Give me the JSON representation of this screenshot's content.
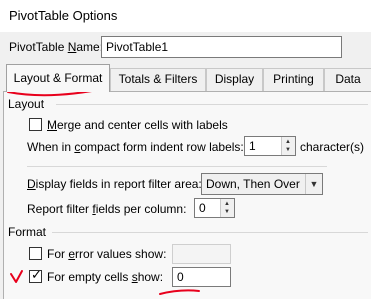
{
  "window": {
    "title": "PivotTable Options"
  },
  "name_field": {
    "label_prefix": "PivotTable ",
    "label_mnemonic": "N",
    "label_suffix": "ame:",
    "value": "PivotTable1"
  },
  "tabs": [
    {
      "label": "Layout & Format",
      "active": true
    },
    {
      "label": "Totals & Filters",
      "active": false
    },
    {
      "label": "Display",
      "active": false
    },
    {
      "label": "Printing",
      "active": false
    },
    {
      "label": "Data",
      "active": false
    }
  ],
  "layout_group": {
    "title": "Layout",
    "merge_center": {
      "mnemonic": "M",
      "rest": "erge and center cells with labels",
      "checked": false
    },
    "indent": {
      "pre": "When in ",
      "mnemonic": "c",
      "post": "ompact form indent row labels:",
      "value": "1",
      "suffix": "character(s)"
    },
    "display_fields": {
      "mnemonic": "D",
      "rest": "isplay fields in report filter area:",
      "value": "Down, Then Over"
    },
    "filter_fields": {
      "pre": "Report filter ",
      "mnemonic": "f",
      "post": "ields per column:",
      "value": "0"
    }
  },
  "format_group": {
    "title": "Format",
    "error_values": {
      "pre": "For ",
      "mnemonic": "e",
      "post": "rror values show:",
      "checked": false,
      "value": ""
    },
    "empty_cells": {
      "pre": "For empty cells ",
      "mnemonic": "s",
      "post": "how:",
      "checked": true,
      "value": "0"
    }
  },
  "annotation_color": "#e8001c"
}
